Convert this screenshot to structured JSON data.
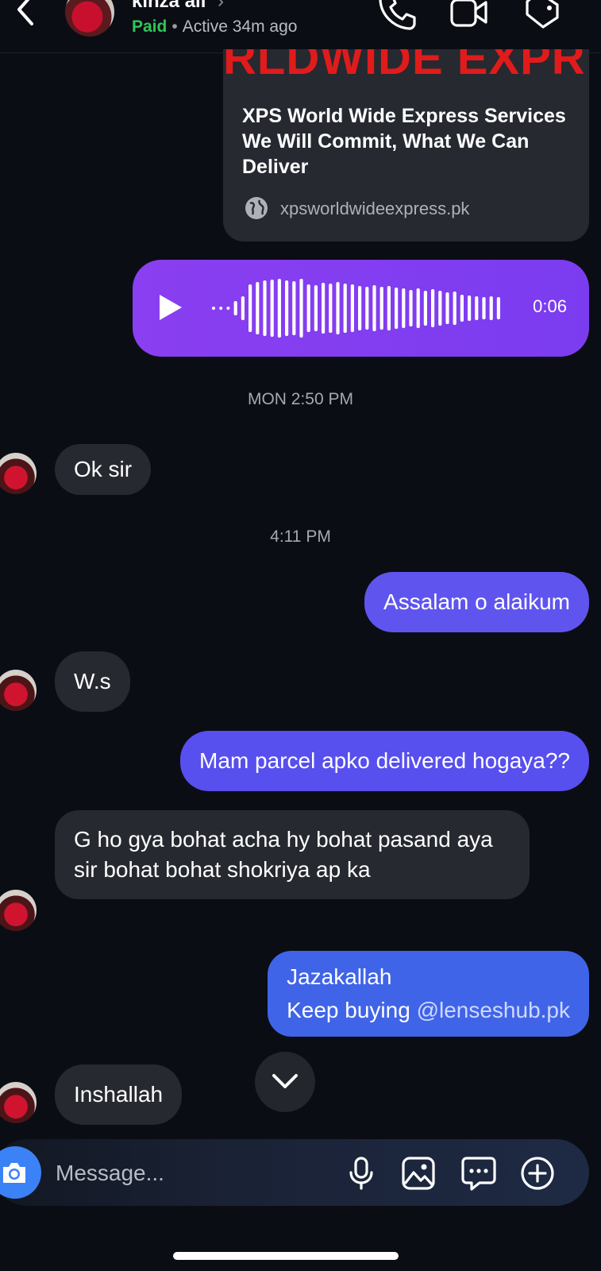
{
  "header": {
    "contact_name": "kinza ali",
    "chevron": "›",
    "status_paid": "Paid",
    "status_separator": "•",
    "status_active": "Active 34m ago",
    "icons": [
      "back-icon",
      "phone-icon",
      "video-icon",
      "tag-icon"
    ]
  },
  "link_card": {
    "brand_text": "RLDWIDE EXPR",
    "title": "XPS World Wide Express Services We Will Commit, What We Can Deliver",
    "url": "xpsworldwideexpress.pk"
  },
  "voice_message": {
    "duration": "0:06",
    "icon": "play-icon"
  },
  "timestamps": {
    "t1": "MON 2:50 PM",
    "t2": "4:11 PM"
  },
  "messages": {
    "m1": "Ok sir",
    "m2": "Assalam o alaikum",
    "m3": "W.s",
    "m4": "Mam parcel apko delivered hogaya??",
    "m5": "G ho gya bohat acha hy bohat pasand aya sir bohat bohat shokriya ap ka",
    "m6_line1": "Jazakallah",
    "m6_line2_prefix": "Keep buying ",
    "m6_mention": "@lenseshub.pk",
    "m7": "Inshallah"
  },
  "composer": {
    "placeholder": "Message...",
    "icons": [
      "camera-icon",
      "microphone-icon",
      "gallery-icon",
      "sticker-icon",
      "plus-icon"
    ]
  },
  "colors": {
    "background": "#0b0d14",
    "incoming_bubble": "#262930",
    "outgoing_purple": "#7b3cf0",
    "outgoing_indigo": "#5b55ee",
    "outgoing_blue": "#3f63e8",
    "paid_green": "#2ec655"
  }
}
